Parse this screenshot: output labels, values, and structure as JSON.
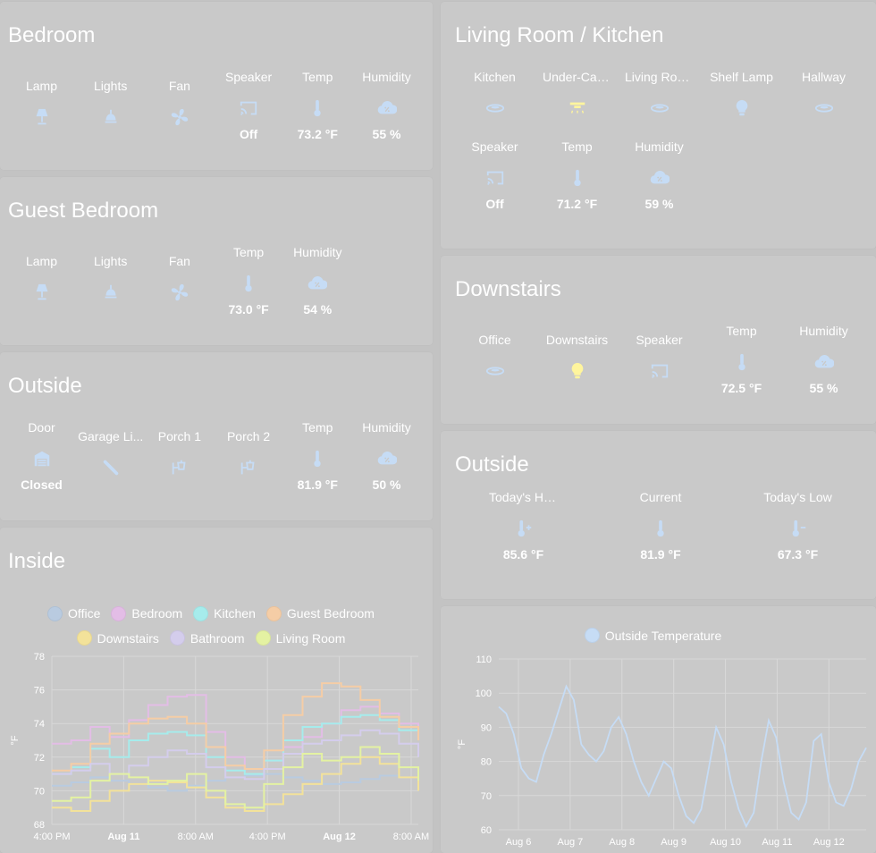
{
  "colors": {
    "icon": "#c6dcf5",
    "on": "#fff59d",
    "text": "#ffffff"
  },
  "bedroom": {
    "title": "Bedroom",
    "entities": [
      {
        "label": "Lamp",
        "icon": "lamp-icon",
        "value": ""
      },
      {
        "label": "Lights",
        "icon": "ceiling-light-icon",
        "value": ""
      },
      {
        "label": "Fan",
        "icon": "fan-icon",
        "value": ""
      },
      {
        "label": "Speaker",
        "icon": "cast-icon",
        "value": "Off"
      },
      {
        "label": "Temp",
        "icon": "thermometer-icon",
        "value": "73.2 °F"
      },
      {
        "label": "Humidity",
        "icon": "humidity-icon",
        "value": "55 %"
      }
    ]
  },
  "guest_bedroom": {
    "title": "Guest Bedroom",
    "entities": [
      {
        "label": "Lamp",
        "icon": "lamp-icon",
        "value": ""
      },
      {
        "label": "Lights",
        "icon": "ceiling-light-icon",
        "value": ""
      },
      {
        "label": "Fan",
        "icon": "fan-icon",
        "value": ""
      },
      {
        "label": "Temp",
        "icon": "thermometer-icon",
        "value": "73.0 °F"
      },
      {
        "label": "Humidity",
        "icon": "humidity-icon",
        "value": "54 %"
      }
    ]
  },
  "outside_left": {
    "title": "Outside",
    "entities": [
      {
        "label": "Door",
        "icon": "garage-icon",
        "value": "Closed"
      },
      {
        "label": "Garage Li...",
        "icon": "light-tube-icon",
        "value": ""
      },
      {
        "label": "Porch 1",
        "icon": "outdoor-lamp-icon",
        "value": ""
      },
      {
        "label": "Porch 2",
        "icon": "outdoor-lamp-icon",
        "value": ""
      },
      {
        "label": "Temp",
        "icon": "thermometer-icon",
        "value": "81.9 °F"
      },
      {
        "label": "Humidity",
        "icon": "humidity-icon",
        "value": "50 %"
      }
    ]
  },
  "inside": {
    "title": "Inside",
    "legend": [
      "Office",
      "Bedroom",
      "Kitchen",
      "Guest Bedroom",
      "Downstairs",
      "Bathroom",
      "Living Room"
    ],
    "legend_colors": [
      "#b9cbe0",
      "#e3bde6",
      "#a6ecec",
      "#f5cda6",
      "#f3e29a",
      "#d4cdec",
      "#e4f2a2"
    ]
  },
  "living": {
    "title": "Living Room / Kitchen",
    "entities": [
      {
        "label": "Kitchen",
        "icon": "ceiling-light-icon-flat",
        "value": ""
      },
      {
        "label": "Under-Cabi...",
        "icon": "under-cabinet-icon",
        "value": ""
      },
      {
        "label": "Living Room",
        "icon": "ceiling-light-icon-flat",
        "value": ""
      },
      {
        "label": "Shelf Lamp",
        "icon": "bulb-icon",
        "value": ""
      },
      {
        "label": "Hallway",
        "icon": "ceiling-light-icon-flat",
        "value": ""
      },
      {
        "label": "Speaker",
        "icon": "cast-icon",
        "value": "Off"
      },
      {
        "label": "Temp",
        "icon": "thermometer-icon",
        "value": "71.2 °F"
      },
      {
        "label": "Humidity",
        "icon": "humidity-icon",
        "value": "59 %"
      }
    ]
  },
  "downstairs": {
    "title": "Downstairs",
    "entities": [
      {
        "label": "Office",
        "icon": "ceiling-light-icon-flat",
        "value": ""
      },
      {
        "label": "Downstairs",
        "icon": "bulb-on-icon",
        "value": ""
      },
      {
        "label": "Speaker",
        "icon": "cast-icon",
        "value": ""
      },
      {
        "label": "Temp",
        "icon": "thermometer-icon",
        "value": "72.5 °F"
      },
      {
        "label": "Humidity",
        "icon": "humidity-icon",
        "value": "55 %"
      }
    ]
  },
  "outside_right": {
    "title": "Outside",
    "entities": [
      {
        "label": "Today's High",
        "icon": "thermometer-plus-icon",
        "value": "85.6 °F"
      },
      {
        "label": "Current",
        "icon": "thermometer-icon",
        "value": "81.9 °F"
      },
      {
        "label": "Today's Low",
        "icon": "thermometer-minus-icon",
        "value": "67.3 °F"
      }
    ]
  },
  "chart_data": [
    {
      "type": "line",
      "ylabel": "°F",
      "ylim": [
        68,
        78
      ],
      "yticks": [
        68,
        70,
        72,
        74,
        76,
        78
      ],
      "xticks": [
        "4:00 PM",
        "Aug 11",
        "8:00 AM",
        "4:00 PM",
        "Aug 12",
        "8:00 AM"
      ],
      "xticks_bold": [
        false,
        true,
        false,
        false,
        true,
        false
      ],
      "series": [
        {
          "name": "Office",
          "color": "#b9cbe0",
          "values": [
            70.3,
            70.5,
            70.8,
            70.6,
            70.4,
            70.2,
            70.0,
            70.3,
            70.6,
            70.8,
            70.9,
            71.0,
            70.8,
            70.6,
            70.4,
            70.5,
            70.7,
            70.9,
            70.8,
            71.0
          ]
        },
        {
          "name": "Bedroom",
          "color": "#e3bde6",
          "values": [
            72.8,
            73.0,
            73.8,
            73.2,
            74.2,
            75.1,
            75.6,
            75.7,
            73.5,
            72.0,
            71.3,
            71.8,
            72.6,
            73.2,
            74.0,
            74.8,
            75.0,
            74.6,
            74.0,
            73.2
          ]
        },
        {
          "name": "Kitchen",
          "color": "#a6ecec",
          "values": [
            71.0,
            71.4,
            72.5,
            72.0,
            73.0,
            73.4,
            73.5,
            73.3,
            72.0,
            71.2,
            71.0,
            71.8,
            73.0,
            73.8,
            74.0,
            74.4,
            74.5,
            74.2,
            73.6,
            73.0
          ]
        },
        {
          "name": "Guest Bedroom",
          "color": "#f5cda6",
          "values": [
            71.2,
            71.6,
            72.8,
            73.4,
            74.0,
            74.3,
            74.4,
            74.0,
            72.6,
            71.5,
            71.3,
            72.4,
            74.5,
            75.6,
            76.4,
            76.2,
            75.4,
            74.4,
            73.8,
            73.0
          ]
        },
        {
          "name": "Downstairs",
          "color": "#f3e29a",
          "values": [
            69.0,
            68.8,
            69.4,
            70.0,
            70.4,
            70.6,
            70.5,
            70.2,
            69.6,
            69.0,
            68.8,
            69.2,
            69.8,
            70.4,
            71.0,
            71.6,
            72.0,
            71.6,
            70.8,
            70.0
          ]
        },
        {
          "name": "Bathroom",
          "color": "#d4cdec",
          "values": [
            71.0,
            71.2,
            71.6,
            71.0,
            71.5,
            72.0,
            72.4,
            72.2,
            71.4,
            70.8,
            70.7,
            71.3,
            72.2,
            72.8,
            73.0,
            73.3,
            73.6,
            73.4,
            72.8,
            72.0
          ]
        },
        {
          "name": "Living Room",
          "color": "#e4f2a2",
          "values": [
            69.4,
            69.6,
            70.6,
            71.0,
            70.8,
            70.4,
            70.6,
            71.0,
            70.0,
            69.2,
            69.0,
            70.4,
            71.4,
            72.2,
            71.8,
            72.0,
            72.6,
            72.2,
            71.4,
            70.6
          ]
        }
      ]
    },
    {
      "type": "line",
      "ylabel": "°F",
      "ylim": [
        60,
        110
      ],
      "yticks": [
        60,
        70,
        80,
        90,
        100,
        110
      ],
      "xticks": [
        "Aug 6",
        "Aug 7",
        "Aug 8",
        "Aug 9",
        "Aug 10",
        "Aug 11",
        "Aug 12"
      ],
      "legend": [
        "Outside Temperature"
      ],
      "series": [
        {
          "name": "Outside Temperature",
          "color": "#c6dcf5",
          "values": [
            96,
            94,
            88,
            78,
            75,
            74,
            82,
            88,
            95,
            102,
            98,
            85,
            82,
            80,
            83,
            90,
            93,
            88,
            80,
            74,
            70,
            75,
            80,
            78,
            70,
            64,
            62,
            66,
            78,
            90,
            85,
            74,
            66,
            61,
            65,
            80,
            92,
            87,
            74,
            65,
            63,
            68,
            86,
            88,
            74,
            68,
            67,
            72,
            80,
            84
          ]
        }
      ]
    }
  ]
}
